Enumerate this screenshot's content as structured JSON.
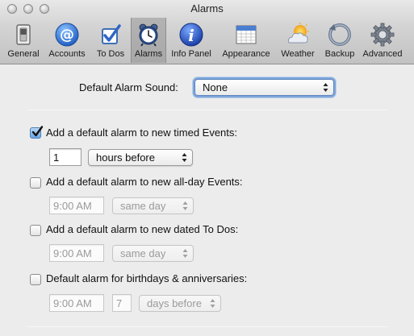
{
  "window": {
    "title": "Alarms"
  },
  "toolbar": {
    "items": [
      {
        "label": "General",
        "icon": "general-switch-icon"
      },
      {
        "label": "Accounts",
        "icon": "at-sign-icon"
      },
      {
        "label": "To Dos",
        "icon": "checkbox-icon"
      },
      {
        "label": "Alarms",
        "icon": "alarm-clock-icon",
        "selected": true
      },
      {
        "label": "Info Panel",
        "icon": "info-icon"
      },
      {
        "label": "Appearance",
        "icon": "calendar-icon"
      },
      {
        "label": "Weather",
        "icon": "weather-icon"
      },
      {
        "label": "Backup",
        "icon": "backup-icon"
      },
      {
        "label": "Advanced",
        "icon": "gear-icon"
      }
    ]
  },
  "alarms": {
    "default_sound_label": "Default Alarm Sound:",
    "default_sound_value": "None",
    "timed": {
      "label": "Add a default alarm to new timed Events:",
      "checked": true,
      "amount": "1",
      "unit": "hours before"
    },
    "allday": {
      "label": "Add a default alarm to new all-day Events:",
      "checked": false,
      "time": "9:00 AM",
      "day": "same day"
    },
    "todos": {
      "label": "Add a default alarm to new dated To Dos:",
      "checked": false,
      "time": "9:00 AM",
      "day": "same day"
    },
    "birthdays": {
      "label": "Default alarm for birthdays & anniversaries:",
      "checked": false,
      "time": "9:00 AM",
      "days": "7",
      "unit": "days before"
    }
  }
}
